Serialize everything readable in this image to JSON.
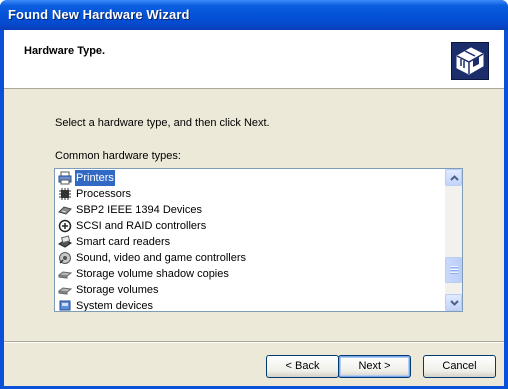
{
  "window": {
    "title": "Found New Hardware Wizard"
  },
  "header": {
    "title": "Hardware Type.",
    "icon": "hardware-device-icon"
  },
  "instruction": "Select a hardware type, and then click Next.",
  "list": {
    "label": "Common hardware types:",
    "items": [
      {
        "label": "Printers",
        "icon": "printer-icon",
        "selected": true
      },
      {
        "label": "Processors",
        "icon": "processor-icon",
        "selected": false
      },
      {
        "label": "SBP2 IEEE 1394 Devices",
        "icon": "ieee1394-icon",
        "selected": false
      },
      {
        "label": "SCSI and RAID controllers",
        "icon": "scsi-icon",
        "selected": false
      },
      {
        "label": "Smart card readers",
        "icon": "smart-card-icon",
        "selected": false
      },
      {
        "label": "Sound, video and game controllers",
        "icon": "sound-icon",
        "selected": false
      },
      {
        "label": "Storage volume shadow copies",
        "icon": "storage-icon",
        "selected": false
      },
      {
        "label": "Storage volumes",
        "icon": "storage-icon",
        "selected": false
      },
      {
        "label": "System devices",
        "icon": "system-device-icon",
        "selected": false
      }
    ]
  },
  "buttons": {
    "back": "< Back",
    "next": "Next >",
    "cancel": "Cancel"
  },
  "colors": {
    "titlebar": "#0452d6",
    "selection": "#316ac5",
    "dialog_bg": "#ece9d8"
  }
}
